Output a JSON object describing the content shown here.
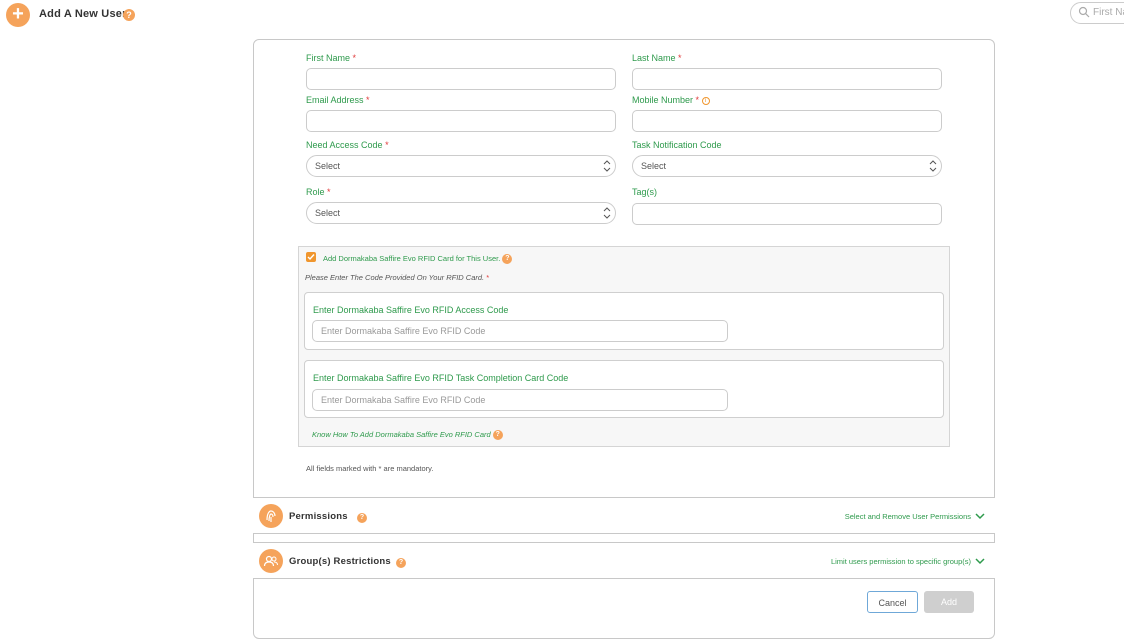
{
  "header": {
    "add_symbol": "+",
    "title": "Add A New User",
    "help_symbol": "?",
    "search_placeholder": "First Na"
  },
  "form": {
    "first_name_label": "First Name",
    "last_name_label": "Last Name",
    "email_label": "Email Address",
    "mobile_label": "Mobile Number",
    "need_access_label": "Need Access Code",
    "task_notif_label": "Task Notification Code",
    "role_label": "Role",
    "tags_label": "Tag(s)",
    "required_mark": "*",
    "info_mark": "i",
    "need_access_value": "Select",
    "task_notif_value": "Select",
    "role_value": "Select",
    "first_name_value": "",
    "last_name_value": "",
    "email_value": "",
    "mobile_value": "",
    "tags_value": ""
  },
  "rfid": {
    "checkbox_label": "Add Dormakaba Saffire Evo RFID Card for This User.",
    "checked": true,
    "instruction": "Please Enter The Code Provided On Your RFID Card.",
    "access_code_label": "Enter Dormakaba Saffire Evo RFID Access Code",
    "access_code_placeholder": "Enter Dormakaba Saffire Evo RFID Code",
    "task_code_label": "Enter Dormakaba Saffire Evo RFID Task Completion Card Code",
    "task_code_placeholder": "Enter Dormakaba Saffire Evo RFID Code",
    "how_to_link": "Know How To Add Dormakaba Saffire Evo RFID Card"
  },
  "mandatory_note": "All fields marked with * are mandatory.",
  "permissions": {
    "title": "Permissions",
    "link": "Select and Remove User Permissions"
  },
  "groups": {
    "title": "Group(s) Restrictions",
    "link": "Limit users permission to specific group(s)"
  },
  "actions": {
    "cancel_label": "Cancel",
    "add_label": "Add"
  },
  "colors": {
    "accent": "#f5a35b",
    "label_green": "#2e9a4c",
    "required_red": "#e03a3a"
  }
}
